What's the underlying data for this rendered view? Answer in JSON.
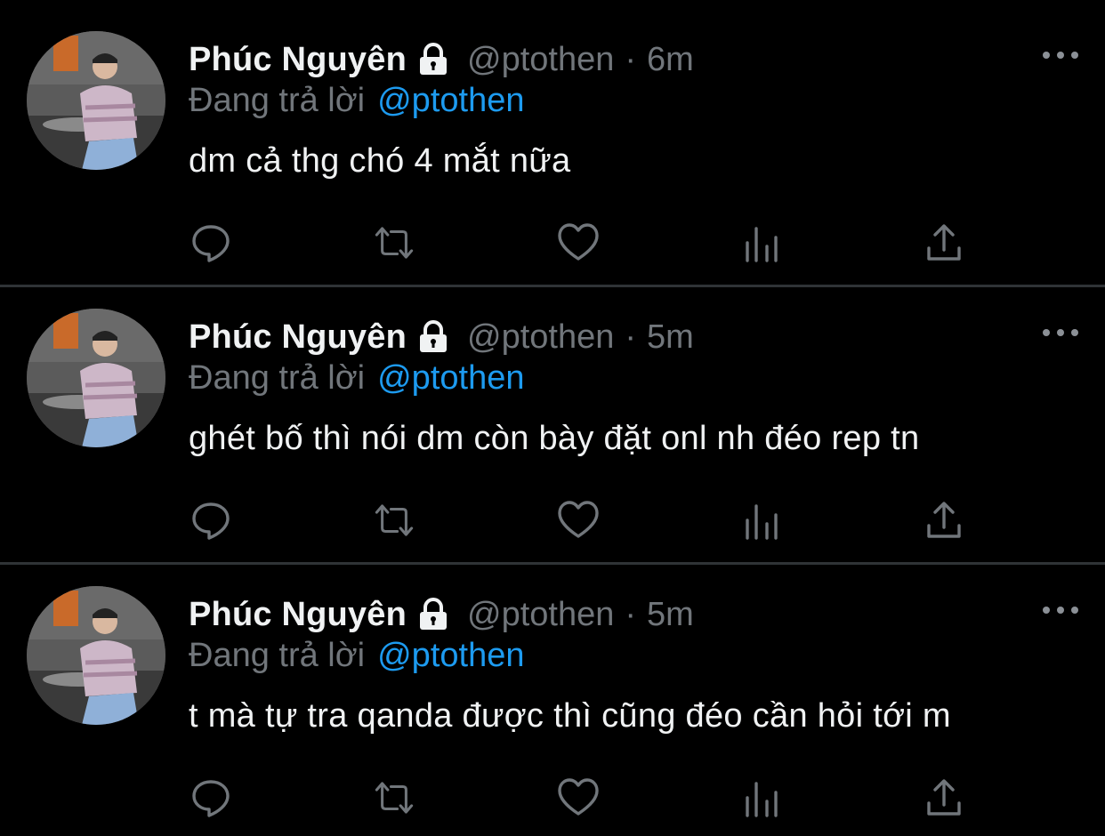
{
  "colors": {
    "background": "#000000",
    "name": "#f0f2f3",
    "secondary": "#71767b",
    "accent_link": "#1d9bf0",
    "divider": "#2f3336"
  },
  "tweets": [
    {
      "author_name": "Phúc Nguyên",
      "handle": "@ptothen",
      "separator": "·",
      "time": "6m",
      "reply_prefix": "Đang trả lời",
      "reply_handle": "@ptothen",
      "text": "dm cả thg chó 4 mắt nữa",
      "icons": [
        "avatar",
        "lock-icon",
        "more-icon",
        "reply-icon",
        "retweet-icon",
        "like-icon",
        "stats-icon",
        "share-icon"
      ]
    },
    {
      "author_name": "Phúc Nguyên",
      "handle": "@ptothen",
      "separator": "·",
      "time": "5m",
      "reply_prefix": "Đang trả lời",
      "reply_handle": "@ptothen",
      "text": "ghét bố thì nói dm còn bày đặt onl nh đéo rep tn",
      "icons": [
        "avatar",
        "lock-icon",
        "more-icon",
        "reply-icon",
        "retweet-icon",
        "like-icon",
        "stats-icon",
        "share-icon"
      ]
    },
    {
      "author_name": "Phúc Nguyên",
      "handle": "@ptothen",
      "separator": "·",
      "time": "5m",
      "reply_prefix": "Đang trả lời",
      "reply_handle": "@ptothen",
      "text": "t mà tự tra qanda được thì cũng đéo cần hỏi tới m",
      "icons": [
        "avatar",
        "lock-icon",
        "more-icon",
        "reply-icon",
        "retweet-icon",
        "like-icon",
        "stats-icon",
        "share-icon"
      ]
    }
  ]
}
